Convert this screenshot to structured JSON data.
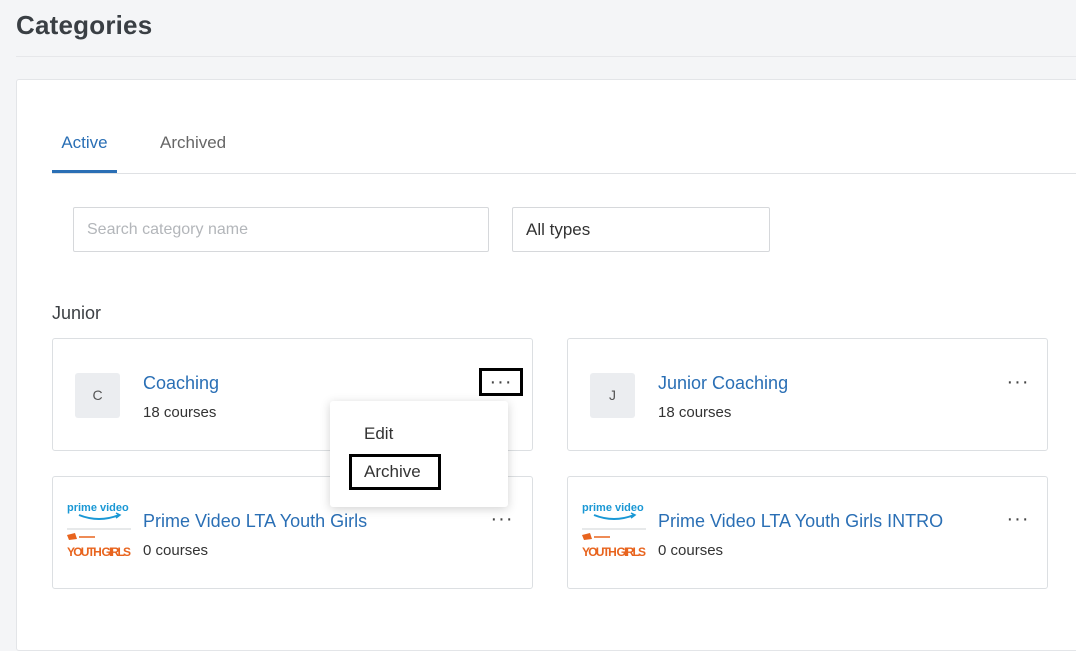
{
  "page": {
    "title": "Categories"
  },
  "tabs": [
    {
      "label": "Active"
    },
    {
      "label": "Archived"
    }
  ],
  "filters": {
    "search_placeholder": "Search category name",
    "type_value": "All types"
  },
  "group": {
    "heading": "Junior"
  },
  "cards": [
    {
      "name": "Coaching",
      "count": "18 courses",
      "avatar": "C"
    },
    {
      "name": "Junior Coaching",
      "count": "18 courses",
      "avatar": "J"
    },
    {
      "name": "Prime Video LTA Youth Girls",
      "count": "0 courses",
      "logo": {
        "line1": "prime video",
        "line2": "YOUTH GIRLS"
      }
    },
    {
      "name": "Prime Video LTA Youth Girls INTRO",
      "count": "0 courses",
      "logo": {
        "line1": "prime video",
        "line2": "YOUTH GIRLS"
      }
    }
  ],
  "menu": {
    "edit_label": "Edit",
    "archive_label": "Archive"
  },
  "more_glyph": "···",
  "colors": {
    "accent": "#2a6fb5",
    "logo_blue": "#1a98d5",
    "logo_orange": "#e8641e"
  }
}
